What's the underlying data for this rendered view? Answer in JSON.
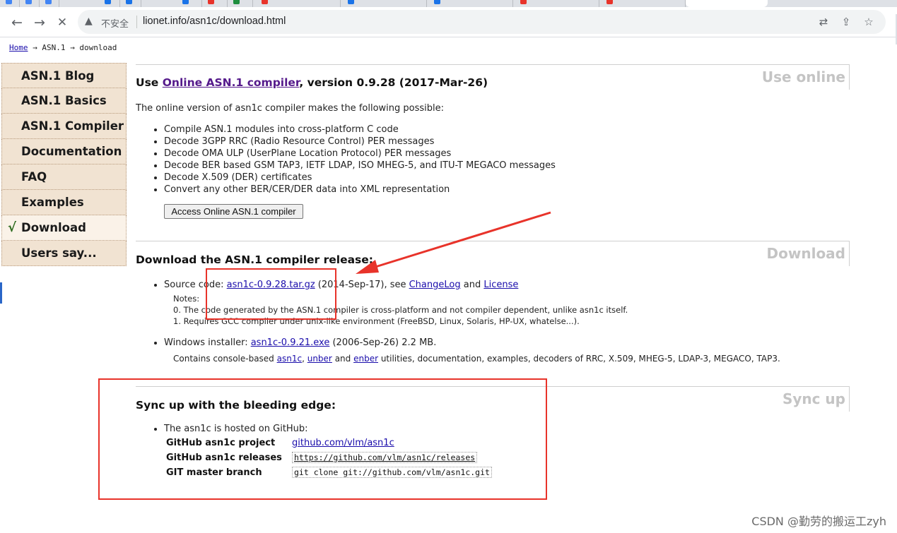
{
  "browser": {
    "security_label": "不安全",
    "url": "lionet.info/asn1c/download.html"
  },
  "breadcrumb": {
    "home": "Home",
    "sep1": "→",
    "asn1": "ASN.1",
    "sep2": "→",
    "current": "download"
  },
  "sidebar": {
    "items": [
      {
        "label": "ASN.1 Blog"
      },
      {
        "label": "ASN.1 Basics"
      },
      {
        "label": "ASN.1 Compiler"
      },
      {
        "label": "Documentation"
      },
      {
        "label": "FAQ"
      },
      {
        "label": "Examples"
      },
      {
        "label": "Download",
        "check": "√"
      },
      {
        "label": "Users say..."
      }
    ]
  },
  "online": {
    "tag": "Use online",
    "heading_prefix": "Use ",
    "heading_link": "Online ASN.1 compiler",
    "heading_suffix": ", version 0.9.28 (2017-Mar-26)",
    "intro": "The online version of asn1c compiler makes the following possible:",
    "bullets": [
      "Compile ASN.1 modules into cross-platform C code",
      "Decode 3GPP RRC (Radio Resource Control) PER messages",
      "Decode OMA ULP (UserPlane Location Protocol) PER messages",
      "Decode BER based GSM TAP3, IETF LDAP, ISO MHEG-5, and ITU-T MEGACO messages",
      "Decode X.509 (DER) certificates",
      "Convert any other BER/CER/DER data into XML representation"
    ],
    "button": "Access Online ASN.1 compiler"
  },
  "download": {
    "tag": "Download",
    "heading": "Download the ASN.1 compiler release:",
    "source_prefix": "Source code: ",
    "source_link": "asn1c-0.9.28.tar.gz",
    "source_mid": " (2014-Sep-17), see ",
    "changelog": "ChangeLog",
    "and": " and ",
    "license": "License",
    "notes_title": "Notes:",
    "note0": "0. The code generated by the ASN.1 compiler is cross-platform and not compiler dependent, unlike asn1c itself.",
    "note1": "1. Requires GCC compiler under unix-like environment (FreeBSD, Linux, Solaris, HP-UX, whatelse...).",
    "win_prefix": "Windows installer: ",
    "win_link": "asn1c-0.9.21.exe",
    "win_suffix": " (2006-Sep-26) 2.2 MB.",
    "contains_prefix": "Contains console-based ",
    "contains_asn1c": "asn1c",
    "contains_comma": ", ",
    "contains_unber": "unber",
    "contains_and": " and ",
    "contains_enber": "enber",
    "contains_suffix": " utilities, documentation, examples, decoders of RRC, X.509, MHEG-5, LDAP-3, MEGACO, TAP3."
  },
  "sync": {
    "tag": "Sync up",
    "heading": "Sync up with the bleeding edge:",
    "hosted": "The asn1c is hosted on GitHub:",
    "rows": [
      {
        "label": "GitHub asn1c project",
        "value": "github.com/vlm/asn1c"
      },
      {
        "label": "GitHub asn1c releases",
        "value": "https://github.com/vlm/asn1c/releases"
      },
      {
        "label": "GIT master branch",
        "value": "git clone git://github.com/vlm/asn1c.git"
      }
    ]
  },
  "annotation_color": "#e8332a",
  "watermark": "CSDN @勤劳的搬运工zyh"
}
